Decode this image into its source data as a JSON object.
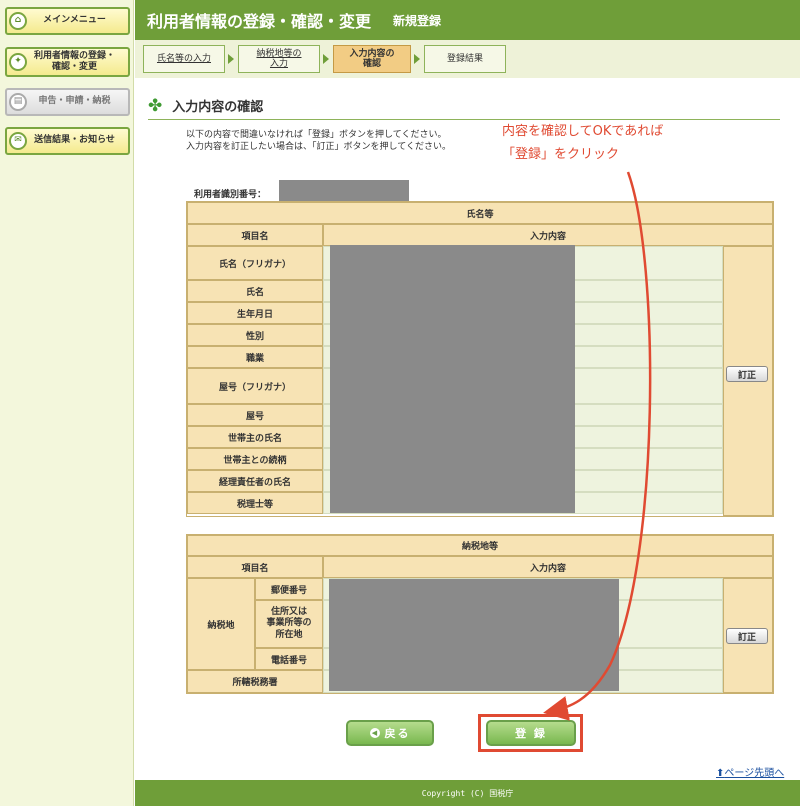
{
  "sidebar": {
    "items": [
      {
        "label": "メインメニュー",
        "icon": "house-icon"
      },
      {
        "label": "利用者情報の登録・\n確認・変更",
        "icon": "settings-icon"
      },
      {
        "label": "申告・申請・納税",
        "icon": "document-icon"
      },
      {
        "label": "送信結果・お知らせ",
        "icon": "mail-icon"
      }
    ]
  },
  "header": {
    "title": "利用者情報の登録・確認・変更",
    "subtitle": "新規登録"
  },
  "steps": [
    {
      "label": "氏名等の入力"
    },
    {
      "label": "納税地等の\n入力"
    },
    {
      "label": "入力内容の\n確認"
    },
    {
      "label": "登録結果"
    }
  ],
  "page_heading": "入力内容の確認",
  "instructions": {
    "line1": "以下の内容で間違いなければ「登録」ボタンを押してください。",
    "line2": "入力内容を訂正したい場合は、「訂正」ボタンを押してください。"
  },
  "annotation": {
    "line1": "内容を確認してOKであれば",
    "line2": "「登録」をクリック"
  },
  "user_id_label": "利用者識別番号：",
  "section_name": {
    "title": "氏名等",
    "col_item": "項目名",
    "col_value": "入力内容",
    "rows": [
      "氏名（フリガナ）",
      "氏名",
      "生年月日",
      "性別",
      "職業",
      "屋号（フリガナ）",
      "屋号",
      "世帯主の氏名",
      "世帯主との続柄",
      "経理責任者の氏名",
      "税理士等"
    ],
    "correct_button": "訂正"
  },
  "section_tax": {
    "title": "納税地等",
    "col_item": "項目名",
    "col_value": "入力内容",
    "group_label": "納税地",
    "sub_rows": [
      "郵便番号",
      "住所又は\n事業所等の\n所在地",
      "電話番号"
    ],
    "office_label": "所轄税務署",
    "correct_button": "訂正"
  },
  "buttons": {
    "back": "戻る",
    "register": "登 録"
  },
  "page_top_link": "ページ先頭へ",
  "footer": "Copyright (C) 国税庁",
  "colors": {
    "header_green": "#6f9e39",
    "accent_red": "#e04a32",
    "table_tan": "#f7e3b4"
  }
}
